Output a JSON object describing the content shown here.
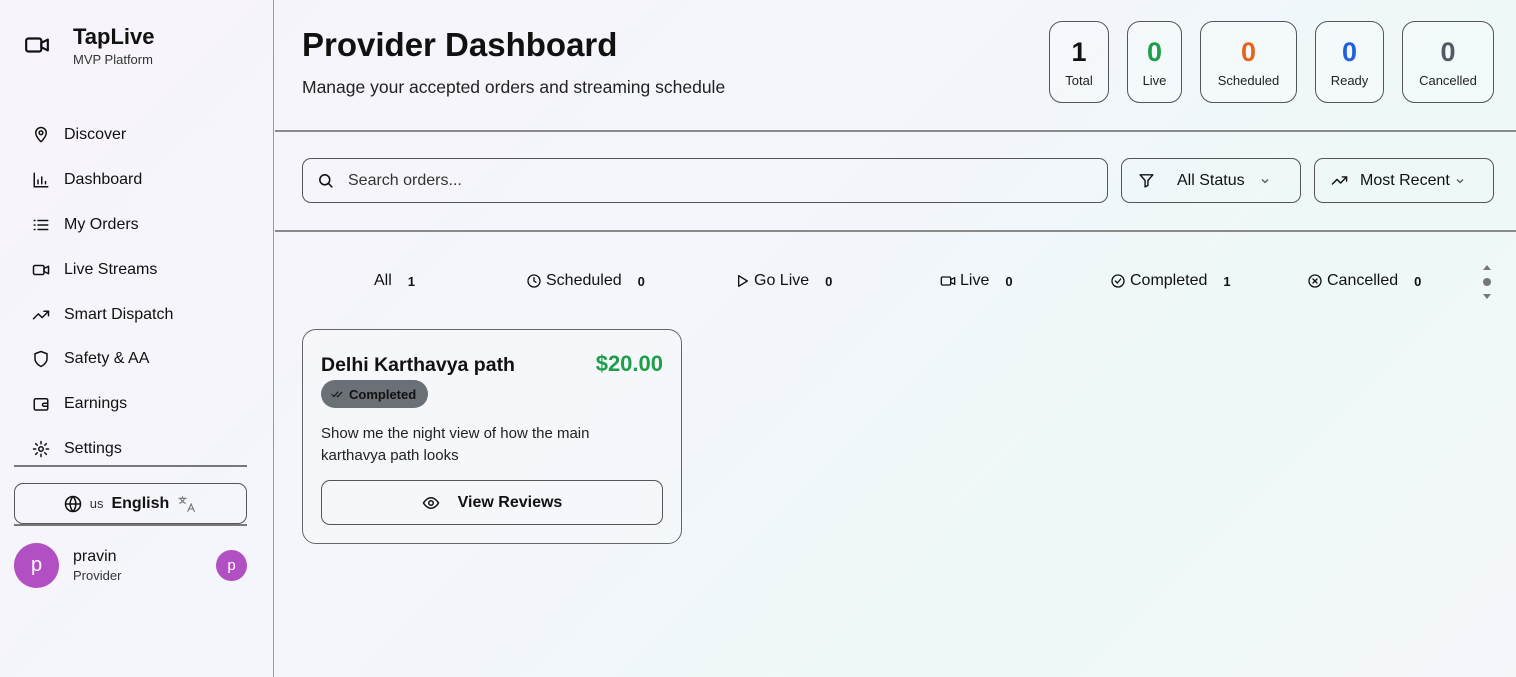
{
  "brand": {
    "title": "TapLive",
    "subtitle": "MVP Platform",
    "icon": "video-camera-icon"
  },
  "sidebar": {
    "items": [
      {
        "label": "Discover",
        "icon": "map-pin-icon"
      },
      {
        "label": "Dashboard",
        "icon": "bar-chart-icon"
      },
      {
        "label": "My Orders",
        "icon": "list-icon"
      },
      {
        "label": "Live Streams",
        "icon": "video-camera-icon"
      },
      {
        "label": "Smart Dispatch",
        "icon": "trending-up-icon"
      },
      {
        "label": "Safety & AA",
        "icon": "shield-icon"
      },
      {
        "label": "Earnings",
        "icon": "wallet-icon"
      },
      {
        "label": "Settings",
        "icon": "gear-icon"
      }
    ],
    "language": {
      "code": "us",
      "name": "English"
    },
    "user": {
      "initial": "p",
      "name": "pravin",
      "role": "Provider"
    }
  },
  "header": {
    "title": "Provider Dashboard",
    "subtitle": "Manage your accepted orders and streaming schedule"
  },
  "stats": [
    {
      "value": "1",
      "label": "Total",
      "color": "#111111"
    },
    {
      "value": "0",
      "label": "Live",
      "color": "#1e9e4a"
    },
    {
      "value": "0",
      "label": "Scheduled",
      "color": "#e8621c"
    },
    {
      "value": "0",
      "label": "Ready",
      "color": "#1f5fe0"
    },
    {
      "value": "0",
      "label": "Cancelled",
      "color": "#555b63"
    }
  ],
  "search": {
    "placeholder": "Search orders..."
  },
  "filters": {
    "status": "All Status",
    "sort": "Most Recent"
  },
  "tabs": [
    {
      "label": "All",
      "count": "1"
    },
    {
      "label": "Scheduled",
      "count": "0"
    },
    {
      "label": "Go Live",
      "count": "0"
    },
    {
      "label": "Live",
      "count": "0"
    },
    {
      "label": "Completed",
      "count": "1"
    },
    {
      "label": "Cancelled",
      "count": "0"
    }
  ],
  "orders": [
    {
      "title": "Delhi Karthavya path",
      "price": "$20.00",
      "status": "Completed",
      "description": "Show me the night view of how the main karthavya path looks",
      "action": "View Reviews"
    }
  ]
}
